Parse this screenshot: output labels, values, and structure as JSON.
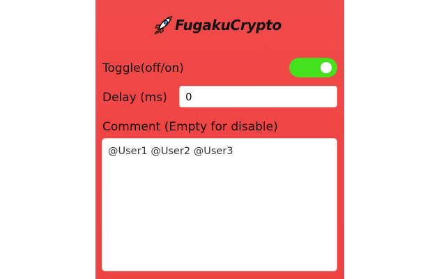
{
  "brand": {
    "name": "FugakuCrypto",
    "icon": "rocket-icon",
    "panel_color": "#f04545",
    "toggle_on_color": "#44e11d"
  },
  "settings": {
    "toggle": {
      "label": "Toggle(off/on)",
      "state": "on"
    },
    "delay": {
      "label": "Delay (ms)",
      "value": "0"
    },
    "comment": {
      "label": "Comment (Empty for disable)",
      "value": "@User1 @User2 @User3"
    }
  }
}
